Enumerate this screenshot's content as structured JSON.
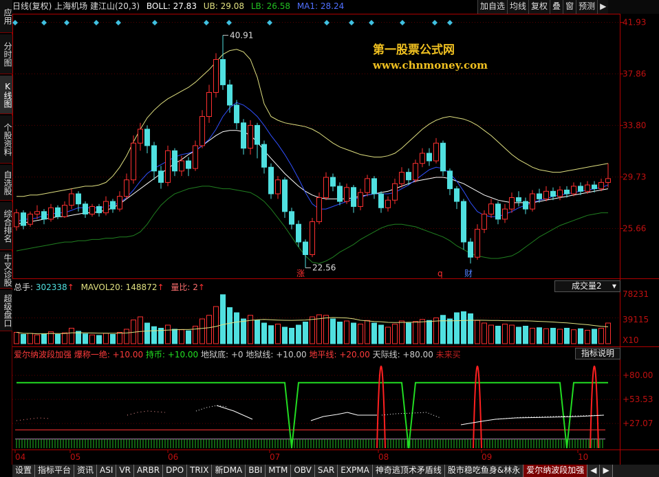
{
  "left_tabs": [
    {
      "label": "应用"
    },
    {
      "label": "分时图"
    },
    {
      "label": "K线图",
      "active": true
    },
    {
      "label": "个股资料"
    },
    {
      "label": "自选股"
    },
    {
      "label": "综合排名"
    },
    {
      "label": "牛叉诊股"
    },
    {
      "label": "超级盘口"
    }
  ],
  "top_info": {
    "stock": "日线(复权) 上海机场 建江山(20,3)",
    "boll_label": "BOLL: 27.83",
    "ub_label": "UB: 29.08",
    "lb_label": "LB: 26.58",
    "ma1_label": "MA1: 28.24"
  },
  "right_tools": [
    "加自选",
    "均线",
    "复权",
    "叠",
    "窗",
    "预测",
    "▶"
  ],
  "price_axis": [
    "41.93",
    "37.86",
    "33.80",
    "29.73",
    "25.66"
  ],
  "annotations": {
    "high": "40.91",
    "low": "22.56",
    "zhang": "涨",
    "q": "q",
    "cai": "财"
  },
  "watermark": {
    "line1": "第一股票公式网",
    "line2": "www.chnmoney.com"
  },
  "volume_info": {
    "zongshou_label": "总手:",
    "zongshou_value": "302338",
    "mavol_label": "MAVOL20:",
    "mavol_value": "148872",
    "liangbi_label": "量比:",
    "liangbi_value": "2"
  },
  "volume_selector": "成交量2",
  "volume_axis": [
    "78231",
    "39115",
    "X10"
  ],
  "indicator_info": {
    "name": "爱尔纳波段加强",
    "items": [
      {
        "text": "爆称一绝: +10.00",
        "color": "#ff3b3b"
      },
      {
        "text": "持币: +10.00",
        "color": "#22e022"
      },
      {
        "text": "地狱底: +0",
        "color": "#cfcfcf"
      },
      {
        "text": "地狱线: +10.00",
        "color": "#cfcfcf"
      },
      {
        "text": "地平线: +20.00",
        "color": "#ff3b3b"
      },
      {
        "text": "天际线: +80.00",
        "color": "#cfcfcf"
      },
      {
        "text": "未来买",
        "color": "#c02020"
      }
    ]
  },
  "indicator_button": "指标说明",
  "indicator_axis": [
    "+80.00",
    "+53.53",
    "+27.07"
  ],
  "x_axis": [
    "04",
    "05",
    "06",
    "07",
    "08",
    "09",
    "10"
  ],
  "bottom_tabs": [
    "设置",
    "指标平台",
    "资讯",
    "ASI",
    "VR",
    "ARBR",
    "DPO",
    "TRIX",
    "新DMA",
    "BBI",
    "MTM",
    "OBV",
    "SAR",
    "EXPMA",
    "神奇逃顶术矛盾线",
    "股市稳吃鱼身&林永",
    "爱尔纳波段加强",
    "◀",
    "▶"
  ],
  "colors": {
    "up": "#ff3030",
    "down": "#50e0e0",
    "axis": "#b00000",
    "boll_mid": "#ffffff",
    "boll_up": "#e0e080",
    "boll_low": "#208020",
    "ma": "#3050ff",
    "green_line": "#22dd22"
  },
  "chart_data": {
    "type": "candlestick",
    "price_ylim": [
      22.0,
      42.5
    ],
    "candles": [
      [
        25.8,
        26.9,
        25.5,
        27.2
      ],
      [
        26.9,
        25.9,
        25.6,
        27.1
      ],
      [
        26.0,
        26.8,
        25.8,
        27.0
      ],
      [
        26.8,
        27.0,
        26.4,
        27.5
      ],
      [
        27.0,
        26.4,
        26.0,
        27.2
      ],
      [
        26.4,
        27.3,
        26.2,
        27.6
      ],
      [
        27.3,
        26.6,
        26.4,
        27.5
      ],
      [
        26.6,
        27.5,
        26.5,
        27.8
      ],
      [
        27.5,
        28.4,
        27.2,
        28.8
      ],
      [
        28.4,
        27.6,
        27.0,
        28.6
      ],
      [
        27.6,
        26.8,
        26.5,
        27.8
      ],
      [
        26.8,
        27.4,
        26.6,
        27.6
      ],
      [
        27.4,
        26.9,
        26.6,
        27.6
      ],
      [
        26.9,
        27.8,
        26.7,
        28.2
      ],
      [
        27.8,
        27.2,
        26.9,
        28.0
      ],
      [
        27.2,
        28.2,
        27.0,
        28.6
      ],
      [
        28.2,
        29.5,
        28.0,
        30.0
      ],
      [
        29.5,
        32.4,
        29.2,
        33.0
      ],
      [
        32.4,
        33.5,
        31.8,
        34.0
      ],
      [
        33.5,
        32.2,
        31.6,
        33.8
      ],
      [
        32.2,
        30.2,
        29.5,
        32.5
      ],
      [
        30.2,
        29.3,
        28.8,
        30.6
      ],
      [
        29.3,
        31.8,
        29.0,
        32.2
      ],
      [
        31.8,
        30.2,
        29.8,
        32.0
      ],
      [
        30.2,
        31.0,
        29.8,
        31.4
      ],
      [
        31.0,
        30.4,
        29.8,
        31.3
      ],
      [
        30.4,
        32.2,
        30.2,
        32.6
      ],
      [
        32.2,
        34.5,
        32.0,
        35.0
      ],
      [
        34.5,
        36.4,
        34.0,
        37.0
      ],
      [
        36.4,
        39.0,
        36.0,
        39.5
      ],
      [
        39.0,
        37.0,
        36.6,
        40.91
      ],
      [
        37.0,
        35.4,
        34.8,
        37.4
      ],
      [
        35.4,
        34.0,
        33.5,
        35.8
      ],
      [
        34.0,
        32.0,
        31.5,
        34.3
      ],
      [
        32.0,
        33.8,
        31.5,
        34.2
      ],
      [
        33.8,
        32.3,
        31.2,
        34.0
      ],
      [
        32.3,
        30.5,
        30.0,
        32.6
      ],
      [
        30.5,
        28.4,
        28.0,
        30.8
      ],
      [
        28.4,
        29.5,
        28.0,
        29.8
      ],
      [
        29.5,
        27.0,
        26.5,
        29.7
      ],
      [
        27.0,
        26.0,
        25.6,
        27.3
      ],
      [
        26.0,
        24.6,
        24.2,
        26.3
      ],
      [
        24.6,
        23.6,
        22.56,
        24.8
      ],
      [
        23.6,
        26.2,
        23.4,
        26.5
      ],
      [
        26.2,
        28.1,
        26.0,
        28.5
      ],
      [
        28.1,
        29.7,
        27.9,
        30.1
      ],
      [
        29.7,
        29.0,
        28.6,
        30.0
      ],
      [
        29.0,
        27.8,
        27.5,
        29.3
      ],
      [
        27.8,
        28.9,
        27.6,
        29.2
      ],
      [
        28.9,
        27.4,
        26.9,
        29.1
      ],
      [
        27.4,
        28.5,
        27.1,
        28.8
      ],
      [
        28.5,
        29.6,
        28.2,
        29.9
      ],
      [
        29.6,
        28.4,
        28.0,
        29.8
      ],
      [
        28.4,
        27.3,
        26.9,
        28.6
      ],
      [
        27.3,
        27.9,
        27.0,
        28.2
      ],
      [
        27.9,
        29.2,
        27.6,
        29.6
      ],
      [
        29.2,
        30.1,
        28.9,
        30.5
      ],
      [
        30.1,
        29.5,
        29.1,
        30.4
      ],
      [
        29.5,
        30.8,
        29.3,
        31.1
      ],
      [
        30.8,
        31.6,
        30.5,
        32.0
      ],
      [
        31.6,
        31.0,
        30.6,
        32.0
      ],
      [
        31.0,
        32.4,
        30.8,
        32.8
      ],
      [
        32.4,
        30.2,
        29.8,
        32.6
      ],
      [
        30.2,
        28.8,
        28.3,
        30.4
      ],
      [
        28.8,
        27.8,
        27.2,
        29.0
      ],
      [
        27.8,
        24.6,
        24.0,
        28.0
      ],
      [
        24.6,
        23.4,
        22.9,
        24.9
      ],
      [
        23.4,
        25.6,
        23.2,
        26.0
      ],
      [
        25.6,
        26.8,
        25.3,
        27.1
      ],
      [
        26.8,
        27.6,
        26.5,
        28.0
      ],
      [
        27.6,
        26.4,
        26.0,
        27.8
      ],
      [
        26.4,
        27.2,
        26.1,
        27.6
      ],
      [
        27.2,
        28.1,
        26.9,
        28.5
      ],
      [
        28.1,
        27.8,
        27.4,
        28.6
      ],
      [
        27.8,
        27.2,
        26.8,
        28.1
      ],
      [
        27.2,
        28.4,
        27.0,
        28.7
      ],
      [
        28.4,
        28.0,
        27.7,
        28.8
      ],
      [
        28.0,
        28.6,
        27.8,
        29.0
      ],
      [
        28.6,
        28.2,
        27.9,
        28.9
      ],
      [
        28.2,
        28.7,
        27.9,
        29.0
      ],
      [
        28.7,
        28.4,
        28.1,
        29.0
      ],
      [
        28.4,
        29.0,
        28.2,
        29.3
      ],
      [
        29.0,
        28.6,
        28.3,
        29.3
      ],
      [
        28.6,
        29.1,
        28.4,
        29.4
      ],
      [
        29.1,
        28.8,
        28.5,
        29.4
      ],
      [
        28.8,
        29.3,
        28.6,
        29.6
      ],
      [
        29.3,
        29.6,
        28.9,
        30.8
      ]
    ],
    "boll_upper": [
      28.2,
      28.2,
      28.3,
      28.3,
      28.4,
      28.5,
      28.6,
      28.7,
      28.8,
      28.9,
      29.0,
      29.0,
      29.1,
      29.3,
      29.8,
      30.5,
      31.4,
      32.5,
      33.5,
      34.4,
      35.0,
      35.5,
      35.9,
      36.2,
      36.5,
      36.8,
      37.2,
      37.7,
      38.2,
      38.8,
      39.4,
      39.7,
      39.8,
      39.6,
      39.0,
      37.6,
      35.5,
      34.5,
      34.2,
      34.0,
      33.9,
      33.8,
      33.7,
      33.5,
      33.2,
      32.8,
      32.4,
      32.1,
      31.9,
      31.7,
      31.5,
      31.4,
      31.3,
      31.3,
      31.4,
      31.6,
      32.0,
      32.5,
      33.0,
      33.5,
      33.9,
      34.2,
      34.4,
      34.5,
      34.4,
      34.3,
      34.1,
      33.8,
      33.4,
      33.0,
      32.5,
      32.0,
      31.5,
      31.1,
      30.8,
      30.5,
      30.3,
      30.2,
      30.1,
      30.1,
      30.2,
      30.3,
      30.4,
      30.5,
      30.6,
      30.7,
      30.8
    ],
    "boll_mid": [
      26.0,
      26.1,
      26.2,
      26.3,
      26.4,
      26.5,
      26.6,
      26.6,
      26.7,
      26.8,
      26.9,
      26.9,
      27.0,
      27.1,
      27.3,
      27.6,
      28.0,
      28.4,
      28.8,
      29.2,
      29.6,
      30.0,
      30.4,
      30.8,
      31.1,
      31.5,
      31.8,
      32.2,
      32.6,
      33.0,
      33.3,
      33.4,
      33.4,
      33.3,
      33.0,
      32.5,
      31.8,
      31.2,
      30.6,
      30.0,
      29.5,
      29.0,
      28.6,
      28.3,
      28.1,
      28.0,
      28.0,
      28.0,
      28.0,
      28.1,
      28.2,
      28.3,
      28.4,
      28.5,
      28.6,
      28.8,
      29.0,
      29.2,
      29.4,
      29.5,
      29.6,
      29.7,
      29.7,
      29.6,
      29.4,
      29.2,
      28.9,
      28.6,
      28.3,
      28.1,
      27.9,
      27.8,
      27.7,
      27.7,
      27.7,
      27.7,
      27.8,
      27.9,
      28.0,
      28.1,
      28.2,
      28.3,
      28.4,
      28.5,
      28.6,
      28.7,
      28.8
    ],
    "boll_lower": [
      23.9,
      24.0,
      24.1,
      24.2,
      24.3,
      24.4,
      24.5,
      24.6,
      24.6,
      24.7,
      24.7,
      24.8,
      24.8,
      24.9,
      24.9,
      25.0,
      25.0,
      25.1,
      25.4,
      26.0,
      26.8,
      27.5,
      28.0,
      28.4,
      28.6,
      28.8,
      28.9,
      29.0,
      29.0,
      28.9,
      28.8,
      28.8,
      28.7,
      28.6,
      28.5,
      28.2,
      27.8,
      27.2,
      26.5,
      25.8,
      25.0,
      24.2,
      23.5,
      23.0,
      22.9,
      23.1,
      23.4,
      23.8,
      24.1,
      24.4,
      24.8,
      25.1,
      25.4,
      25.7,
      25.9,
      26.0,
      26.0,
      25.9,
      25.8,
      25.6,
      25.4,
      25.2,
      25.0,
      24.7,
      24.3,
      24.0,
      23.7,
      23.5,
      23.4,
      23.3,
      23.3,
      23.4,
      23.5,
      23.8,
      24.2,
      24.6,
      25.0,
      25.3,
      25.6,
      25.9,
      26.1,
      26.3,
      26.5,
      26.7,
      26.8,
      26.9,
      26.9
    ],
    "ma": [
      26.2,
      26.4,
      26.4,
      26.5,
      26.7,
      26.8,
      26.9,
      26.9,
      27.1,
      27.3,
      27.3,
      27.3,
      27.3,
      27.4,
      27.5,
      27.7,
      28.1,
      28.7,
      29.4,
      30.0,
      30.4,
      30.7,
      31.0,
      31.3,
      31.5,
      31.6,
      31.8,
      32.2,
      32.7,
      33.5,
      34.5,
      35.2,
      35.6,
      35.4,
      35.0,
      34.5,
      33.8,
      33.0,
      32.3,
      31.5,
      30.6,
      29.6,
      28.5,
      27.6,
      27.2,
      27.2,
      27.4,
      27.6,
      27.8,
      28.0,
      28.1,
      28.3,
      28.4,
      28.4,
      28.4,
      28.5,
      28.8,
      29.1,
      29.5,
      29.9,
      30.3,
      30.5,
      30.4,
      30.0,
      29.4,
      28.6,
      27.7,
      27.0,
      26.7,
      26.6,
      26.6,
      26.8,
      27.0,
      27.3,
      27.5,
      27.7,
      27.9,
      28.0,
      28.2,
      28.3,
      28.4,
      28.5,
      28.6,
      28.7,
      28.8,
      28.9,
      29.1
    ],
    "volumes": [
      22,
      18,
      20,
      17,
      19,
      23,
      18,
      21,
      30,
      24,
      19,
      17,
      16,
      20,
      18,
      22,
      28,
      46,
      52,
      40,
      33,
      30,
      36,
      28,
      27,
      25,
      34,
      48,
      55,
      72,
      95,
      70,
      60,
      48,
      55,
      46,
      40,
      35,
      38,
      32,
      30,
      36,
      42,
      52,
      56,
      55,
      48,
      42,
      44,
      40,
      38,
      45,
      40,
      36,
      32,
      38,
      44,
      40,
      43,
      47,
      45,
      50,
      55,
      48,
      60,
      62,
      58,
      45,
      40,
      36,
      34,
      38,
      36,
      32,
      34,
      30,
      31,
      29,
      30,
      28,
      30,
      27,
      29,
      26,
      28,
      30,
      40
    ],
    "volume_ylim": [
      0,
      100
    ],
    "indicator_ylim": [
      0,
      100
    ],
    "indicator_green_dips": [
      [
        40,
        41
      ],
      [
        57,
        58
      ],
      [
        80,
        81
      ]
    ],
    "indicator_red_spikes": [
      53,
      67,
      84
    ]
  }
}
